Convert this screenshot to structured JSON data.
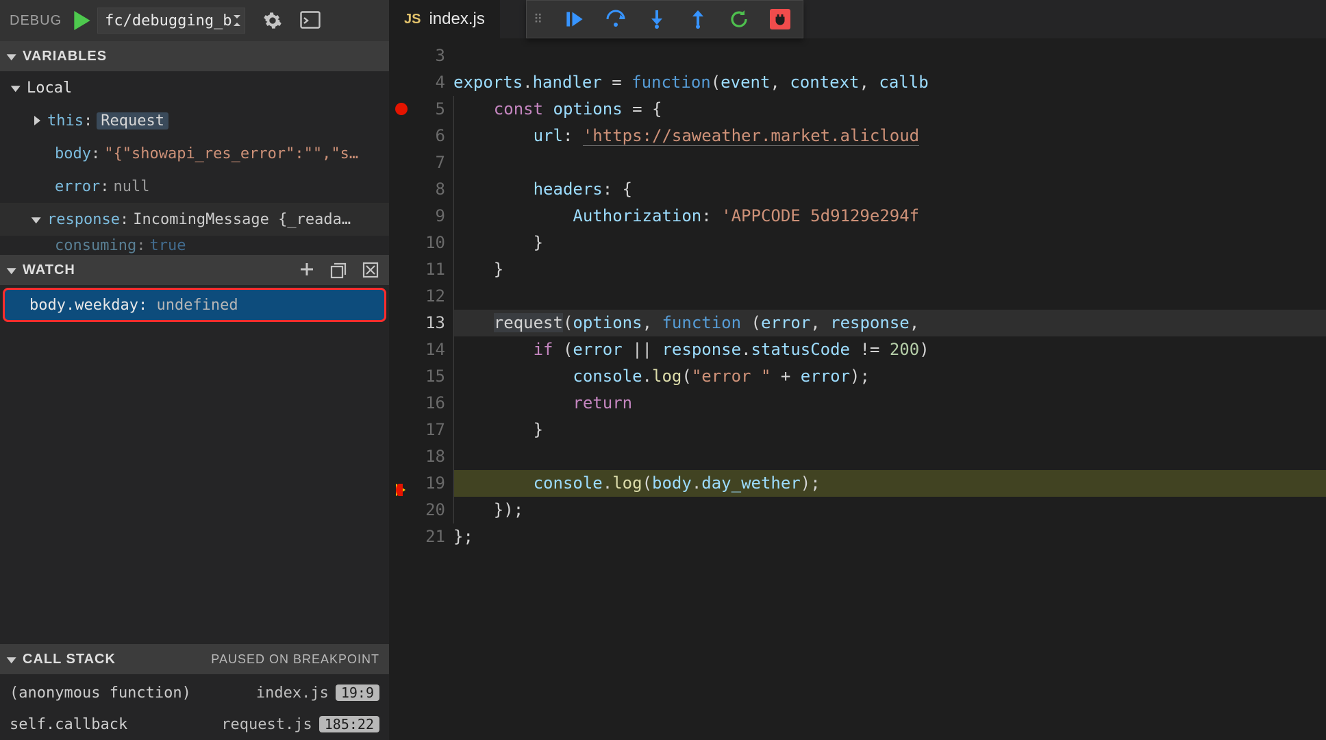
{
  "debug": {
    "label": "DEBUG",
    "config": "fc/debugging_b"
  },
  "sections": {
    "variables": "VARIABLES",
    "watch": "WATCH",
    "callstack": "CALL STACK",
    "pausedStatus": "PAUSED ON BREAKPOINT"
  },
  "variables": {
    "scope": "Local",
    "rows": [
      {
        "name": "this",
        "value": "Request",
        "kind": "boxed",
        "expandable": true
      },
      {
        "name": "body",
        "value": "\"{\"showapi_res_error\":\"\",\"s…",
        "kind": "string",
        "expandable": false
      },
      {
        "name": "error",
        "value": "null",
        "kind": "null",
        "expandable": false
      },
      {
        "name": "response",
        "value": "IncomingMessage {_reada…",
        "kind": "object",
        "expandable": true
      }
    ],
    "peek": {
      "name": "consuming",
      "value": "true"
    }
  },
  "watch": {
    "items": [
      {
        "expr": "body.weekday",
        "value": "undefined"
      }
    ]
  },
  "callstack": {
    "frames": [
      {
        "name": "(anonymous function)",
        "file": "index.js",
        "loc": "19:9"
      },
      {
        "name": "self.callback",
        "file": "request.js",
        "loc": "185:22"
      }
    ]
  },
  "editor": {
    "filename": "index.js",
    "jsBadge": "JS",
    "lineStart": 3,
    "lineEnd": 21,
    "breakpointLine": 5,
    "currentLine": 19,
    "cursorLine": 13,
    "tokens": {
      "exports": "exports",
      "handler": "handler",
      "function": "function",
      "event": "event",
      "context": "context",
      "callback": "callb",
      "const": "const",
      "options": "options",
      "url": "url",
      "urlValue": "'https://saweather.market.alicloud",
      "headers": "headers",
      "auth": "Authorization",
      "authValue": "'APPCODE 5d9129e294f",
      "request": "request",
      "error": "error",
      "response": "response",
      "if": "if",
      "statusCode": "statusCode",
      "n200": "200",
      "console": "console",
      "log": "log",
      "errStr": "\"error \"",
      "return": "return",
      "body": "body",
      "day_wether": "day_wether"
    }
  },
  "icons": {
    "play": "play-icon",
    "gear": "gear-icon",
    "console": "debug-console-icon",
    "add": "add-icon",
    "collapse": "collapse-all-icon",
    "clear": "clear-all-icon",
    "continue": "continue-icon",
    "stepOver": "step-over-icon",
    "stepInto": "step-into-icon",
    "stepOut": "step-out-icon",
    "restart": "restart-icon",
    "stop": "disconnect-icon",
    "grip": "grip-icon"
  }
}
